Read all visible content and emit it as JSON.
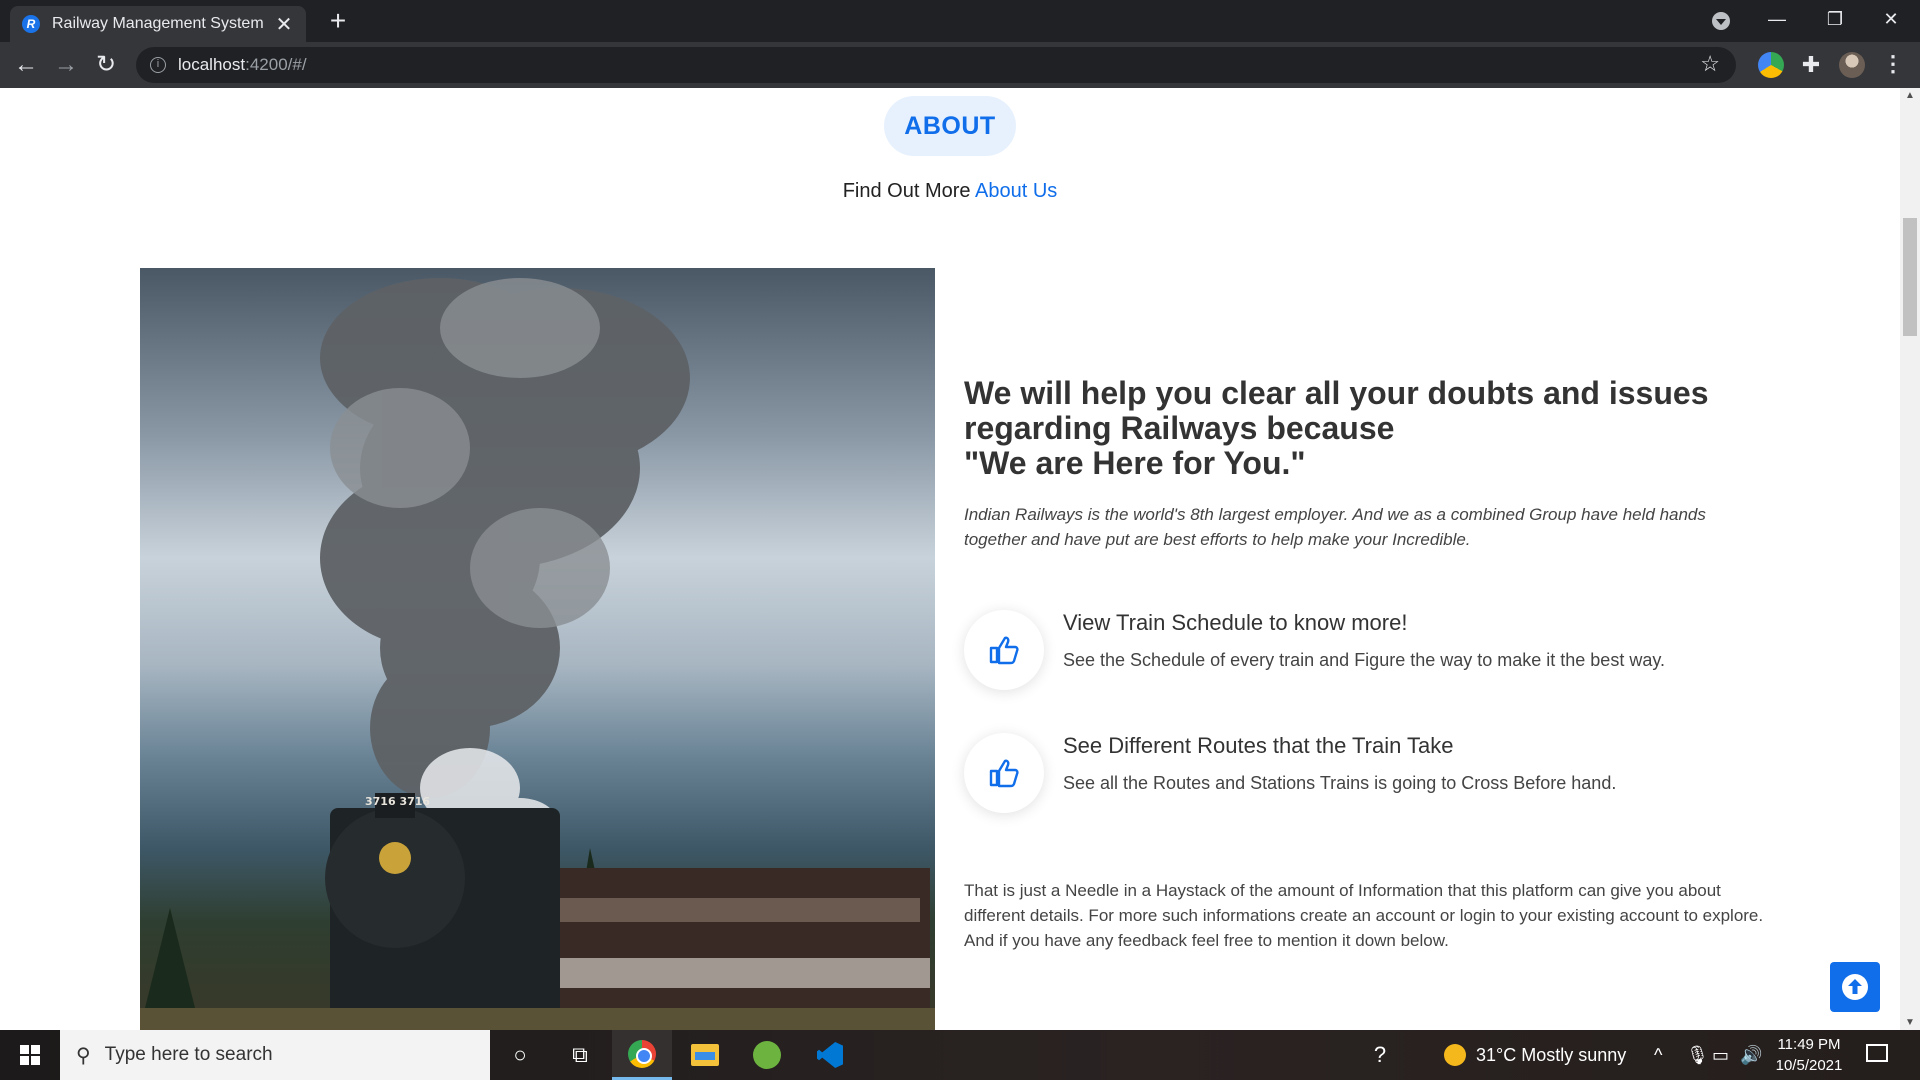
{
  "browser": {
    "tab_title": "Railway Management System",
    "favicon_letter": "R",
    "url_host": "localhost",
    "url_rest": ":4200/#/"
  },
  "page": {
    "section_badge": "ABOUT",
    "find_more_prefix": "Find Out More ",
    "find_more_link": "About Us",
    "headline_line1": "We will help you clear all your doubts and issues",
    "headline_line2": "regarding Railways because",
    "headline_line3": "\"We are Here for You.\"",
    "intro": "Indian Railways is the world's 8th largest employer. And we as a combined Group have held hands together and have put are best efforts to help make your Incredible.",
    "features": [
      {
        "icon": "thumbs-up-icon",
        "title": "View Train Schedule to know more!",
        "description": "See the Schedule of every train and Figure the way to make it the best way."
      },
      {
        "icon": "thumbs-up-icon",
        "title": "See Different Routes that the Train Take",
        "description": "See all the Routes and Stations Trains is going to Cross Before hand."
      }
    ],
    "closing": "That is just a Needle in a Haystack of the amount of Information that this platform can give you about different details. For more such informations create an account or login to your existing account to explore. And if you have any feedback feel free to mention it down below.",
    "locomotive_number": "3716 3716",
    "accent_color": "#106eea"
  },
  "taskbar": {
    "search_placeholder": "Type here to search",
    "temperature": "31°C",
    "weather": "Mostly sunny",
    "time": "11:49 PM",
    "date": "10/5/2021"
  }
}
